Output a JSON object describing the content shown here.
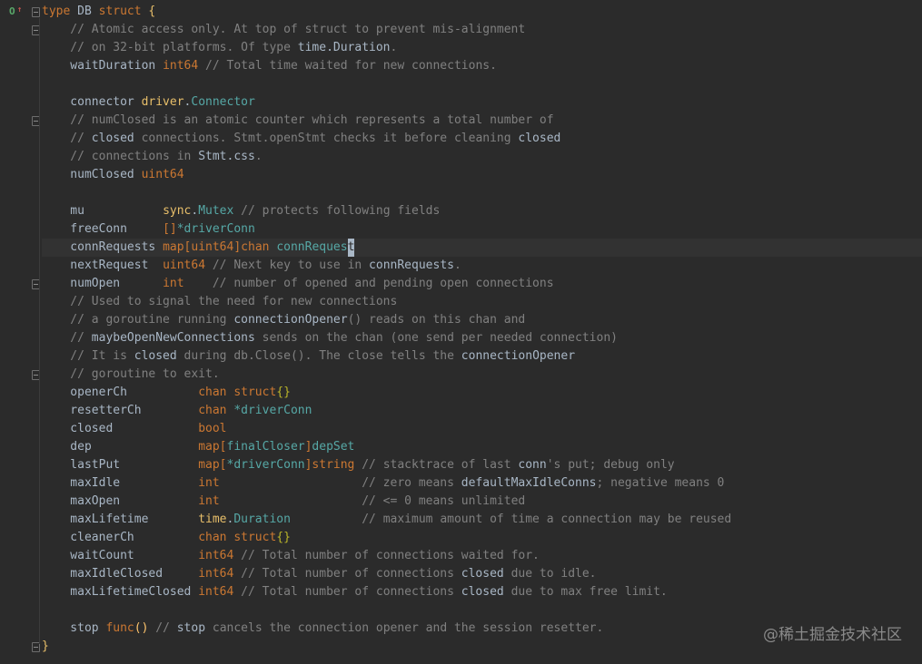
{
  "editor": {
    "lines": [
      [
        {
          "t": "type ",
          "c": "kw"
        },
        {
          "t": "DB ",
          "c": "ident"
        },
        {
          "t": "struct ",
          "c": "kw"
        },
        {
          "t": "{",
          "c": "brace"
        }
      ],
      [
        {
          "t": "    // Atomic access only. At top of struct to prevent mis-alignment",
          "c": "cm"
        }
      ],
      [
        {
          "t": "    // on 32-bit platforms. Of type ",
          "c": "cm"
        },
        {
          "t": "time.Duration",
          "c": "cmb"
        },
        {
          "t": ".",
          "c": "cm"
        }
      ],
      [
        {
          "t": "    waitDuration ",
          "c": "fld"
        },
        {
          "t": "int64",
          "c": "kw"
        },
        {
          "t": " // Total time waited for new connections.",
          "c": "cm"
        }
      ],
      [
        {
          "t": "",
          "c": "cm"
        }
      ],
      [
        {
          "t": "    connector ",
          "c": "fld"
        },
        {
          "t": "driver",
          "c": "pkg"
        },
        {
          "t": ".",
          "c": "dot"
        },
        {
          "t": "Connector",
          "c": "teal"
        }
      ],
      [
        {
          "t": "    // numClosed",
          "c": "cm"
        },
        {
          "t": "",
          "c": "cm"
        },
        {
          "t": " is an atomic counter which represents a total number of",
          "c": "cm"
        }
      ],
      [
        {
          "t": "    // ",
          "c": "cm"
        },
        {
          "t": "closed",
          "c": "cmb"
        },
        {
          "t": " connections. Stmt.openStmt checks it before cleaning ",
          "c": "cm"
        },
        {
          "t": "closed",
          "c": "cmb"
        }
      ],
      [
        {
          "t": "    // connections in ",
          "c": "cm"
        },
        {
          "t": "Stmt.css",
          "c": "cmb"
        },
        {
          "t": ".",
          "c": "cm"
        }
      ],
      [
        {
          "t": "    numClosed ",
          "c": "fld"
        },
        {
          "t": "uint64",
          "c": "kw"
        }
      ],
      [
        {
          "t": "",
          "c": "cm"
        }
      ],
      [
        {
          "t": "    mu           ",
          "c": "fld"
        },
        {
          "t": "sync",
          "c": "pkg"
        },
        {
          "t": ".",
          "c": "dot"
        },
        {
          "t": "Mutex",
          "c": "teal"
        },
        {
          "t": " // protects following fields",
          "c": "cm"
        }
      ],
      [
        {
          "t": "    freeConn     ",
          "c": "fld"
        },
        {
          "t": "[]",
          "c": "kw"
        },
        {
          "t": "*driverConn",
          "c": "teal"
        }
      ],
      [
        {
          "t": "    connRequests ",
          "c": "fld"
        },
        {
          "t": "map[",
          "c": "kw"
        },
        {
          "t": "uint64",
          "c": "kw"
        },
        {
          "t": "]chan ",
          "c": "kw"
        },
        {
          "t": "connReques",
          "c": "teal"
        },
        {
          "t": "t",
          "c": "caret"
        }
      ],
      [
        {
          "t": "    nextRequest  ",
          "c": "fld"
        },
        {
          "t": "uint64",
          "c": "kw"
        },
        {
          "t": " // Next key to use in ",
          "c": "cm"
        },
        {
          "t": "connRequests",
          "c": "cmb"
        },
        {
          "t": ".",
          "c": "cm"
        }
      ],
      [
        {
          "t": "    numOpen      ",
          "c": "fld"
        },
        {
          "t": "int",
          "c": "kw"
        },
        {
          "t": "    // number of opened and pending open connections",
          "c": "cm"
        }
      ],
      [
        {
          "t": "    // Used to signal the need for new connections",
          "c": "cm"
        }
      ],
      [
        {
          "t": "    // a goroutine running ",
          "c": "cm"
        },
        {
          "t": "connectionOpener",
          "c": "cmb"
        },
        {
          "t": "() reads on this chan and",
          "c": "cm"
        }
      ],
      [
        {
          "t": "    // ",
          "c": "cm"
        },
        {
          "t": "maybeOpenNewConnections",
          "c": "cmb"
        },
        {
          "t": " sends on the chan (one send per needed connection)",
          "c": "cm"
        }
      ],
      [
        {
          "t": "    // It is ",
          "c": "cm"
        },
        {
          "t": "closed",
          "c": "cmb"
        },
        {
          "t": " during db.Close(). The close tells the ",
          "c": "cm"
        },
        {
          "t": "connectionOpener",
          "c": "cmb"
        }
      ],
      [
        {
          "t": "    // goroutine to exit.",
          "c": "cm"
        }
      ],
      [
        {
          "t": "    openerCh          ",
          "c": "fld"
        },
        {
          "t": "chan struct",
          "c": "kw"
        },
        {
          "t": "{}",
          "c": "yel"
        }
      ],
      [
        {
          "t": "    resetterCh        ",
          "c": "fld"
        },
        {
          "t": "chan ",
          "c": "kw"
        },
        {
          "t": "*driverConn",
          "c": "teal"
        }
      ],
      [
        {
          "t": "    closed            ",
          "c": "fld"
        },
        {
          "t": "bool",
          "c": "kw"
        }
      ],
      [
        {
          "t": "    dep               ",
          "c": "fld"
        },
        {
          "t": "map[",
          "c": "kw"
        },
        {
          "t": "finalCloser",
          "c": "teal"
        },
        {
          "t": "]",
          "c": "kw"
        },
        {
          "t": "depSet",
          "c": "teal"
        }
      ],
      [
        {
          "t": "    lastPut           ",
          "c": "fld"
        },
        {
          "t": "map[",
          "c": "kw"
        },
        {
          "t": "*driverConn",
          "c": "teal"
        },
        {
          "t": "]string",
          "c": "kw"
        },
        {
          "t": " // stacktrace of last ",
          "c": "cm"
        },
        {
          "t": "conn",
          "c": "cmb"
        },
        {
          "t": "'s put; debug only",
          "c": "cm"
        }
      ],
      [
        {
          "t": "    maxIdle           ",
          "c": "fld"
        },
        {
          "t": "int",
          "c": "kw"
        },
        {
          "t": "                    // zero means ",
          "c": "cm"
        },
        {
          "t": "defaultMaxIdleConns",
          "c": "cmb"
        },
        {
          "t": "; negative means 0",
          "c": "cm"
        }
      ],
      [
        {
          "t": "    maxOpen           ",
          "c": "fld"
        },
        {
          "t": "int",
          "c": "kw"
        },
        {
          "t": "                    // <= 0 means unlimited",
          "c": "cm"
        }
      ],
      [
        {
          "t": "    maxLifetime       ",
          "c": "fld"
        },
        {
          "t": "time",
          "c": "pkg"
        },
        {
          "t": ".",
          "c": "dot"
        },
        {
          "t": "Duration",
          "c": "teal"
        },
        {
          "t": "          // maximum amount of time a connection may be reused",
          "c": "cm"
        }
      ],
      [
        {
          "t": "    cleanerCh         ",
          "c": "fld"
        },
        {
          "t": "chan struct",
          "c": "kw"
        },
        {
          "t": "{}",
          "c": "yel"
        }
      ],
      [
        {
          "t": "    waitCount         ",
          "c": "fld"
        },
        {
          "t": "int64",
          "c": "kw"
        },
        {
          "t": " // Total number of connections waited for.",
          "c": "cm"
        }
      ],
      [
        {
          "t": "    maxIdleClosed     ",
          "c": "fld"
        },
        {
          "t": "int64",
          "c": "kw"
        },
        {
          "t": " // Total number of connections ",
          "c": "cm"
        },
        {
          "t": "closed",
          "c": "cmb"
        },
        {
          "t": " due to idle.",
          "c": "cm"
        }
      ],
      [
        {
          "t": "    maxLifetimeClosed ",
          "c": "fld"
        },
        {
          "t": "int64",
          "c": "kw"
        },
        {
          "t": " // Total number of connections ",
          "c": "cm"
        },
        {
          "t": "closed",
          "c": "cmb"
        },
        {
          "t": " due to max free limit.",
          "c": "cm"
        }
      ],
      [
        {
          "t": "",
          "c": "cm"
        }
      ],
      [
        {
          "t": "    stop ",
          "c": "fld"
        },
        {
          "t": "func",
          "c": "kw"
        },
        {
          "t": "()",
          "c": "pkg2"
        },
        {
          "t": " // ",
          "c": "cm"
        },
        {
          "t": "stop",
          "c": "cmb"
        },
        {
          "t": " cancels the connection opener and the session resetter.",
          "c": "cm"
        }
      ],
      [
        {
          "t": "}",
          "c": "brace"
        }
      ]
    ],
    "current_line": 13,
    "fold_lines": [
      0,
      1,
      6,
      15,
      20,
      35
    ],
    "gutter_icon": "implementations-icon"
  },
  "watermark": "@稀土掘金技术社区",
  "colors": {
    "background": "#2b2b2b",
    "keyword": "#cc7832",
    "comment": "#808080",
    "type": "#56a8a6"
  }
}
